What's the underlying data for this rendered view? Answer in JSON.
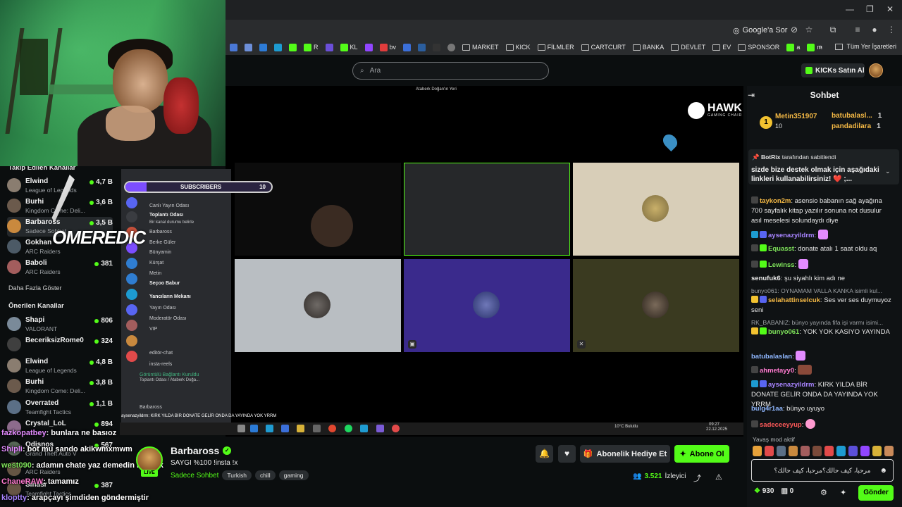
{
  "browser": {
    "google_search_label": "Google'a Sor",
    "bookmarks": [
      {
        "label": "R",
        "color": "#53fc18"
      },
      {
        "label": "KL",
        "color": "#53fc18"
      },
      {
        "label": "bv",
        "color": "#e03c3c"
      },
      {
        "label": "MARKET",
        "folder": true
      },
      {
        "label": "KICK",
        "folder": true
      },
      {
        "label": "FİLMLER",
        "folder": true
      },
      {
        "label": "CARTCURT",
        "folder": true
      },
      {
        "label": "BANKA",
        "folder": true
      },
      {
        "label": "DEVLET",
        "folder": true
      },
      {
        "label": "EV",
        "folder": true
      },
      {
        "label": "SPONSOR",
        "folder": true
      },
      {
        "label": "a",
        "color": "#53fc18"
      },
      {
        "label": "m",
        "color": "#53fc18"
      }
    ],
    "all_bookmarks_label": "Tüm Yer İşaretleri",
    "more_label": "»"
  },
  "header": {
    "search_placeholder": "Ara",
    "kicks_button": "KICKs Satın Al"
  },
  "sidebar": {
    "followed_title": "Takip Edilen Kanallar",
    "followed": [
      {
        "name": "Elwind",
        "category": "League of Legends",
        "viewers": "4,7 B",
        "color": "#8a7d70"
      },
      {
        "name": "Burhi",
        "category": "Kingdom Come: Deli...",
        "viewers": "3,6 B",
        "color": "#6b5a4c"
      },
      {
        "name": "Barbaross",
        "category": "Sadece Sohbet",
        "viewers": "3,5 B",
        "color": "#c9893e"
      },
      {
        "name": "Gokhan",
        "category": "ARC Raiders",
        "viewers": "",
        "color": "#4c5a66"
      },
      {
        "name": "Baboli",
        "category": "ARC Raiders",
        "viewers": "381",
        "color": "#a35d5d"
      }
    ],
    "show_more": "Daha Fazla Göster",
    "suggested_title": "Önerilen Kanallar",
    "suggested": [
      {
        "name": "Shapi",
        "category": "VALORANT",
        "viewers": "806",
        "color": "#7a8a99"
      },
      {
        "name": "BeceriksizRome0",
        "category": "",
        "viewers": "324",
        "color": "#3f3f3f"
      },
      {
        "name": "Elwind",
        "category": "League of Legends",
        "viewers": "4,8 B",
        "color": "#8a7d70"
      },
      {
        "name": "Burhi",
        "category": "Kingdom Come: Deli...",
        "viewers": "3,8 B",
        "color": "#6b5a4c"
      },
      {
        "name": "Overrated",
        "category": "Teamfight Tactics",
        "viewers": "1,1 B",
        "color": "#5b6f86"
      },
      {
        "name": "Crystal_LoL",
        "category": "",
        "viewers": "894",
        "color": "#8c6b8c"
      },
      {
        "name": "Odisnos",
        "category": "Grand Theft Auto V",
        "viewers": "567",
        "color": "#556655"
      },
      {
        "name": "Sinasr",
        "category": "ARC Raiders",
        "viewers": "",
        "color": "#665544"
      },
      {
        "name": "Sinasr",
        "category": "Teamfight Tactics",
        "viewers": "387",
        "color": "#665544"
      }
    ]
  },
  "overlay_chat": [
    {
      "user": "fazkopatbey",
      "text": ": bunlara ne basıoz",
      "cls": "u"
    },
    {
      "user": "Shipli",
      "text": ": bot mu sando akikwmxmwm",
      "cls": "u"
    },
    {
      "user": "west090",
      "text": ": adamın chate yaz demedin mi amk",
      "cls": "u2"
    },
    {
      "user": "ChaneRAW",
      "text": ": tamamız",
      "cls": "u4"
    },
    {
      "user": "kloptty",
      "text": ": arapçayı şimdiden göndermiştir",
      "cls": "u3"
    }
  ],
  "watermark": "OMEREDIC",
  "discord": {
    "bar_label": "SUBSCRIBERS",
    "bar_count": "10",
    "lines": [
      {
        "text": "Canlı Yayın Odası",
        "bold": false
      },
      {
        "text": "Toplantı Odası",
        "bold": true
      },
      {
        "text": "Bir kanal durumu belirle",
        "bold": false
      },
      {
        "text": "Barbaross",
        "bold": false
      },
      {
        "text": "Berke Güler",
        "bold": false
      },
      {
        "text": "Bünyamin",
        "bold": false
      },
      {
        "text": "Kürşat",
        "bold": false
      },
      {
        "text": "Metin",
        "bold": false
      },
      {
        "text": "Seçoo Babur",
        "bold": true
      },
      {
        "text": "Yancıların Mekanı",
        "bold": true
      },
      {
        "text": "Yayın Odası",
        "bold": false
      },
      {
        "text": "Moderatör Odası",
        "bold": false
      },
      {
        "text": "VIP",
        "bold": false
      },
      {
        "text": "editör-chat",
        "bold": false
      },
      {
        "text": "insta-reels",
        "bold": false
      },
      {
        "text": "Görüntülü Bağlantı Kuruldu",
        "bold": false
      },
      {
        "text": "Toplantı Odası / Ataberk Doğa...",
        "bold": false
      },
      {
        "text": "Barbaross",
        "bold": false
      }
    ]
  },
  "video": {
    "window_title": "Ataberk Doğan'ın Yeri",
    "brand": "HAWK",
    "brand_sub": "GAMING CHAIR",
    "taskbar_weather": "10°C Bulutlu",
    "taskbar_time": "09:27",
    "taskbar_date": "22.12.2025",
    "bottom_overlay": "aysenazyildrm: KIRK YILDA BİR DONATE GELİR ONDA DA YAYINDA YOK YRRM"
  },
  "streamer": {
    "name": "Barbaross",
    "title": "SAYGI %100 !insta !x",
    "category": "Sadece Sohbet",
    "tags": [
      "Turkish",
      "chill",
      "gaming"
    ],
    "live_label": "LIVE",
    "gift_button": "Abonelik Hediye Et",
    "subscribe_button": "Abone Ol",
    "viewers": "3.521",
    "viewers_label": "İzleyici"
  },
  "chat": {
    "title": "Sohbet",
    "leaderboard": {
      "top_name": "Metin351907",
      "top_value": "10",
      "others": [
        {
          "name": "batubalasl...",
          "value": "1"
        },
        {
          "name": "pandadilara",
          "value": "1"
        }
      ]
    },
    "pinned_by": "BotRix",
    "pinned_by_suffix": "tarafından sabitlendi",
    "pinned_text": "sizde bize destek olmak için aşağıdaki linkleri kullanabilirsiniz! ❤️ ;...",
    "messages": [
      {
        "user": "taykon2m",
        "color": "#f5b945",
        "text": "asensio babanın sağ ayağına 700 sayfalık kitap yazılır sonuna not dusulur asıl meselesi solundaydı diye",
        "reply": "",
        "lines": 3
      },
      {
        "user": "aysenazyildrm",
        "color": "#a884ff",
        "text": "",
        "reply": "",
        "lines": 1
      },
      {
        "user": "Equasst",
        "color": "#7ee35a",
        "text": "donate atalı 1 saat oldu aq",
        "reply": "",
        "lines": 1
      },
      {
        "user": "Lewinss",
        "color": "#7ee35a",
        "text": "",
        "reply": "",
        "lines": 1
      },
      {
        "user": "senufuk6",
        "color": "#e8e8e8",
        "text": "şu siyahlı kim adı ne",
        "reply": "",
        "lines": 1
      },
      {
        "user": "selahattinselcuk",
        "color": "#f5b945",
        "text": "Ses ver ses duymuyoz seni",
        "reply": "bunyo061: OYNAMAM VALLA KANKA isimli kul...",
        "lines": 3
      },
      {
        "user": "bunyo061",
        "color": "#7ee35a",
        "text": "YOK YOK KASIYO YAYINDA",
        "reply": "RK_BABANIZ: bünyo yayında fifa işi varmı isimi...",
        "lines": 3
      },
      {
        "user": "batubalasIan",
        "color": "#8fb7ff",
        "text": "",
        "reply": "",
        "lines": 1
      },
      {
        "user": "ahmetayy0",
        "color": "#ff7bd0",
        "text": "",
        "reply": "",
        "lines": 1
      },
      {
        "user": "aysenazyildrm",
        "color": "#a884ff",
        "text": "KIRK YILDA BİR DONATE GELİR ONDA DA YAYINDA YOK YRRM",
        "reply": "",
        "lines": 2
      },
      {
        "user": "bulg4r1aa",
        "color": "#8fb7ff",
        "text": "bünyo uyuyo",
        "reply": "",
        "lines": 1
      },
      {
        "user": "sadeceeyyup",
        "color": "#ff5a5a",
        "text": "",
        "reply": "",
        "lines": 1
      }
    ],
    "slow_mode": "Yavaş mod aktif",
    "input_value": "مرحبا، كيف حالك؟مرحبا، كيف حالك؟",
    "points": "930",
    "gifts": "0",
    "send_button": "Gönder"
  },
  "colors": {
    "kick_green": "#53fc18",
    "bg": "#0b0e0f"
  }
}
